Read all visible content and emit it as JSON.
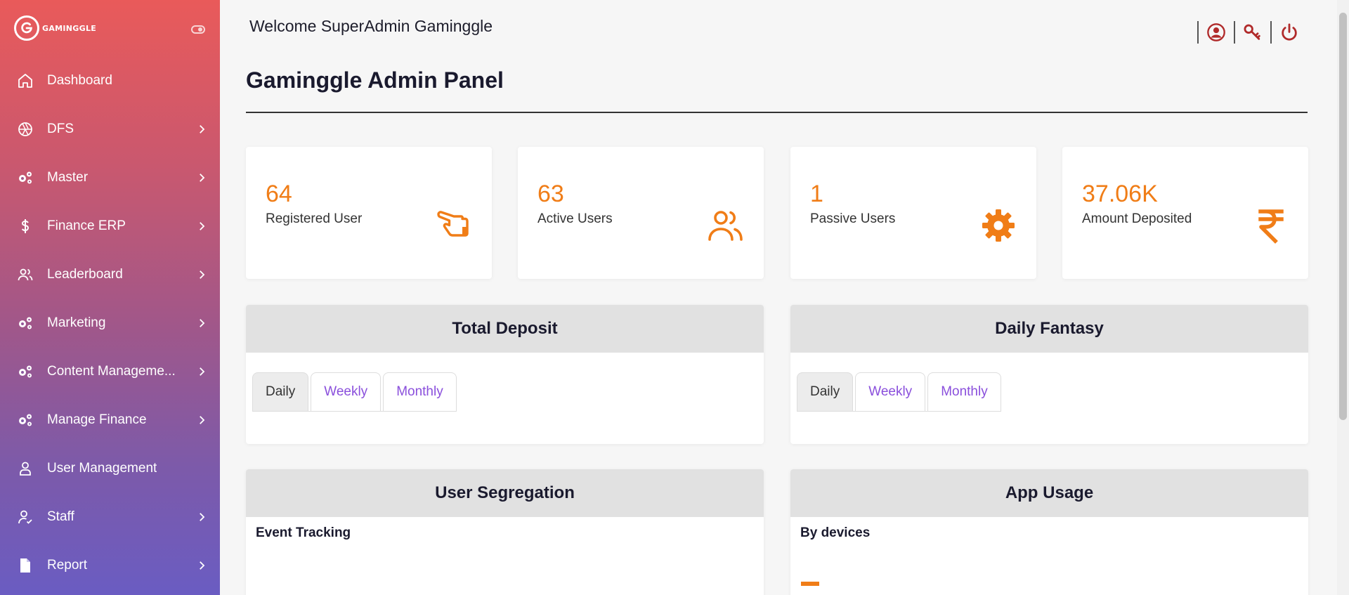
{
  "brand": {
    "logo_letter": "G",
    "name": "GAMINGGLE"
  },
  "sidebar": {
    "items": [
      {
        "label": "Dashboard",
        "icon": "home-icon",
        "has_chevron": false
      },
      {
        "label": "DFS",
        "icon": "aperture-icon",
        "has_chevron": true
      },
      {
        "label": "Master",
        "icon": "gears-icon",
        "has_chevron": true
      },
      {
        "label": "Finance ERP",
        "icon": "dollar-icon",
        "has_chevron": true
      },
      {
        "label": "Leaderboard",
        "icon": "users-icon",
        "has_chevron": true
      },
      {
        "label": "Marketing",
        "icon": "gears-icon",
        "has_chevron": true
      },
      {
        "label": "Content Manageme...",
        "icon": "gears-icon",
        "has_chevron": true
      },
      {
        "label": "Manage Finance",
        "icon": "gears-icon",
        "has_chevron": true
      },
      {
        "label": "User Management",
        "icon": "user-icon",
        "has_chevron": false
      },
      {
        "label": "Staff",
        "icon": "user-check-icon",
        "has_chevron": true
      },
      {
        "label": "Report",
        "icon": "file-icon",
        "has_chevron": true
      }
    ]
  },
  "header": {
    "welcome": "Welcome SuperAdmin Gaminggle",
    "icons": [
      "profile-icon",
      "key-icon",
      "power-icon"
    ]
  },
  "page": {
    "title": "Gaminggle Admin Panel"
  },
  "stats": [
    {
      "value": "64",
      "label": "Registered User",
      "icon": "hand-pointer-icon"
    },
    {
      "value": "63",
      "label": "Active Users",
      "icon": "users-icon"
    },
    {
      "value": "1",
      "label": "Passive Users",
      "icon": "gear-icon"
    },
    {
      "value": "37.06K",
      "label": "Amount Deposited",
      "icon": "rupee-icon"
    }
  ],
  "panels": {
    "total_deposit": {
      "title": "Total Deposit",
      "tabs": [
        "Daily",
        "Weekly",
        "Monthly"
      ],
      "active_tab": "Daily"
    },
    "daily_fantasy": {
      "title": "Daily Fantasy",
      "tabs": [
        "Daily",
        "Weekly",
        "Monthly"
      ],
      "active_tab": "Daily"
    },
    "user_segregation": {
      "title": "User Segregation",
      "subtitle": "Event Tracking"
    },
    "app_usage": {
      "title": "App Usage",
      "subtitle": "By devices"
    }
  },
  "colors": {
    "accent": "#f07d17",
    "tab_link": "#8a4fdc",
    "sidebar_top": "#e95a5a",
    "sidebar_bottom": "#6a5cc2",
    "header_icon": "#b02a2a"
  }
}
